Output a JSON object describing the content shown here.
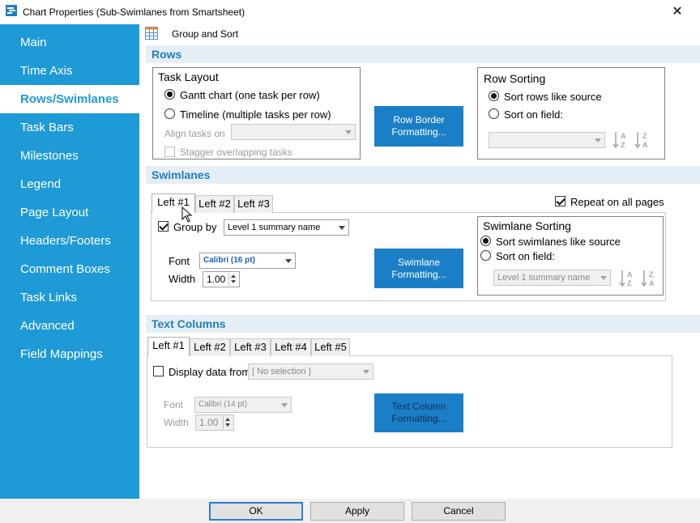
{
  "window": {
    "title": "Chart Properties (Sub-Swimlanes from Smartsheet)"
  },
  "sidebar": {
    "items": [
      {
        "label": "Main"
      },
      {
        "label": "Time Axis"
      },
      {
        "label": "Rows/Swimlanes"
      },
      {
        "label": "Task Bars"
      },
      {
        "label": "Milestones"
      },
      {
        "label": "Legend"
      },
      {
        "label": "Page Layout"
      },
      {
        "label": "Headers/Footers"
      },
      {
        "label": "Comment Boxes"
      },
      {
        "label": "Task Links"
      },
      {
        "label": "Advanced"
      },
      {
        "label": "Field Mappings"
      }
    ],
    "active": "Rows/Swimlanes"
  },
  "toolbar": {
    "group_sort_label": "Group and Sort"
  },
  "rows": {
    "header": "Rows",
    "task_layout": {
      "title": "Task Layout",
      "gantt_label": "Gantt chart (one task per row)",
      "timeline_label": "Timeline (multiple tasks per row)",
      "align_label": "Align tasks on",
      "align_value": "",
      "stagger_label": "Stagger overlapping tasks",
      "selected": "gantt"
    },
    "row_border_button": "Row Border Formatting...",
    "row_sorting": {
      "title": "Row Sorting",
      "like_source_label": "Sort rows like source",
      "on_field_label": "Sort on field:",
      "field_value": "",
      "selected": "like_source"
    }
  },
  "swimlanes": {
    "header": "Swimlanes",
    "tabs": [
      {
        "label": "Left #1"
      },
      {
        "label": "Left #2"
      },
      {
        "label": "Left #3"
      }
    ],
    "repeat_label": "Repeat on all pages",
    "repeat_checked": true,
    "group_by_label": "Group by",
    "group_by_checked": true,
    "group_by_value": "Level 1 summary name",
    "font_label": "Font",
    "font_value": "Calibri (16 pt)",
    "width_label": "Width",
    "width_value": "1.00",
    "formatting_button": "Swimlane Formatting...",
    "sorting": {
      "title": "Swimlane Sorting",
      "like_source_label": "Sort swimlanes like source",
      "on_field_label": "Sort on field:",
      "field_value": "Level 1 summary name",
      "selected": "like_source"
    }
  },
  "text_columns": {
    "header": "Text Columns",
    "tabs": [
      {
        "label": "Left #1"
      },
      {
        "label": "Left #2"
      },
      {
        "label": "Left #3"
      },
      {
        "label": "Left #4"
      },
      {
        "label": "Left #5"
      }
    ],
    "display_label": "Display data from",
    "display_checked": false,
    "display_value": "[ No selection ]",
    "font_label": "Font",
    "font_value": "Calibri (14 pt)",
    "width_label": "Width",
    "width_value": "1.00",
    "formatting_button": "Text Column Formatting..."
  },
  "footer": {
    "ok": "OK",
    "apply": "Apply",
    "cancel": "Cancel"
  },
  "sort_icons": {
    "az": "A Z",
    "za": "Z A"
  },
  "colors": {
    "sidebar": "#1e9ad6",
    "accent_button": "#1a7fc6",
    "section_header_bg": "#e6eef5",
    "section_header_text": "#1e7fc0"
  }
}
